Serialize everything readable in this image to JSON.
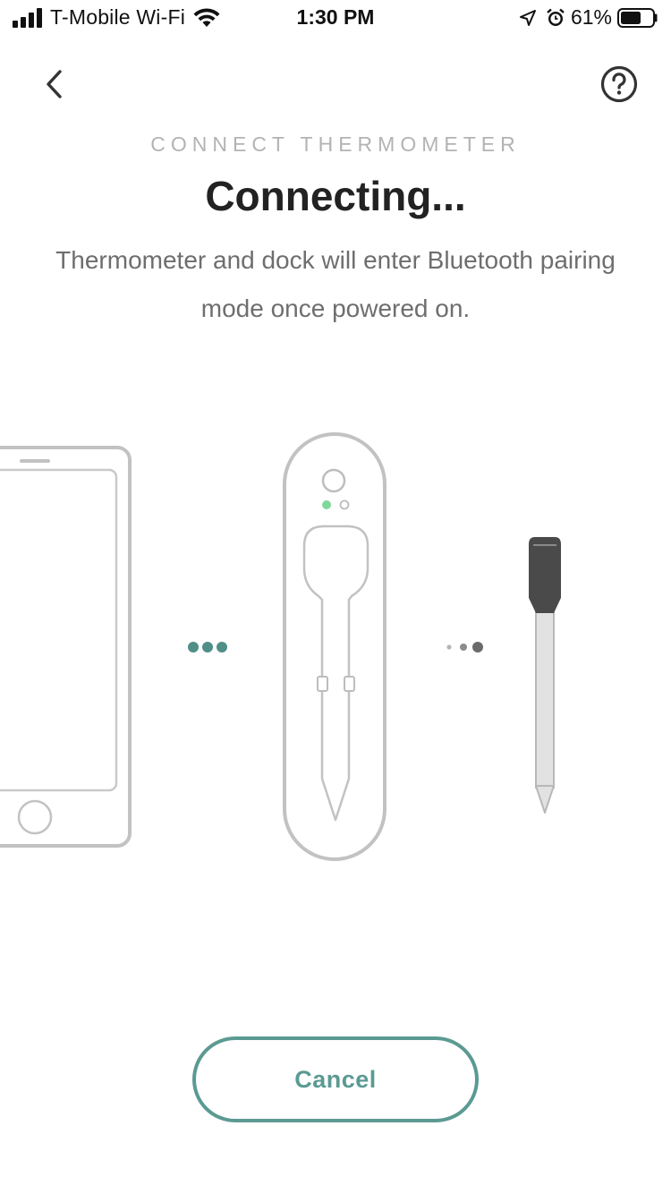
{
  "status_bar": {
    "carrier": "T-Mobile Wi-Fi",
    "time": "1:30 PM",
    "battery_percent": "61%",
    "icons": [
      "signal-bars-icon",
      "wifi-icon",
      "location-arrow-icon",
      "alarm-icon",
      "battery-icon"
    ]
  },
  "nav": {
    "back_icon": "chevron-left-icon",
    "help_icon": "question-circle-icon"
  },
  "header": {
    "eyebrow": "CONNECT THERMOMETER",
    "title": "Connecting...",
    "subtitle": "Thermometer and dock will enter Bluetooth pairing mode once powered on."
  },
  "illustration": {
    "items": [
      "phone-illustration",
      "dock-illustration",
      "thermometer-probe-illustration"
    ],
    "phone_to_dock_indicator": "connecting-dots-active",
    "dock_to_probe_indicator": "connecting-dots-pending",
    "colors": {
      "outline": "#bdbdbd",
      "accent_teal": "#4f8f87",
      "led_green": "#7fd89a",
      "probe_handle": "#4a4a4a",
      "dots_gray": "#777777"
    }
  },
  "actions": {
    "cancel_label": "Cancel",
    "accent_color": "#5b9a92"
  }
}
